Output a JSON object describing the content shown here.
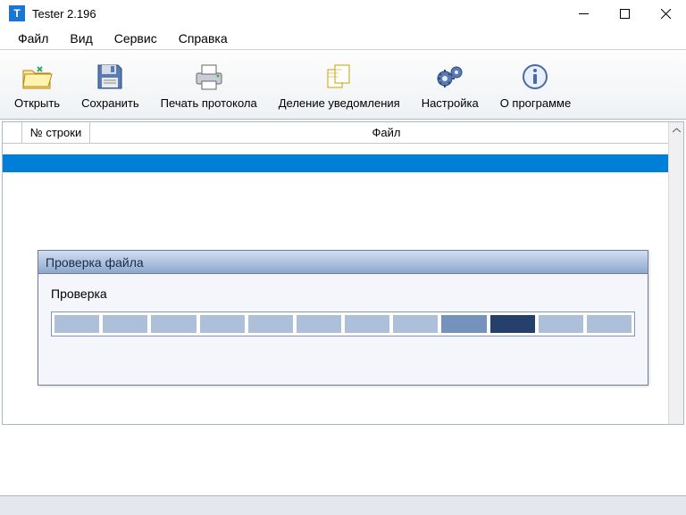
{
  "window": {
    "title": "Tester 2.196"
  },
  "menu": {
    "items": [
      "Файл",
      "Вид",
      "Сервис",
      "Справка"
    ]
  },
  "toolbar": {
    "open": "Открыть",
    "save": "Сохранить",
    "print": "Печать протокола",
    "split": "Деление уведомления",
    "settings": "Настройка",
    "about": "О программе"
  },
  "table": {
    "headers": {
      "row": "№ строки",
      "file": "Файл"
    }
  },
  "dialog": {
    "title": "Проверка файла",
    "label": "Проверка"
  }
}
